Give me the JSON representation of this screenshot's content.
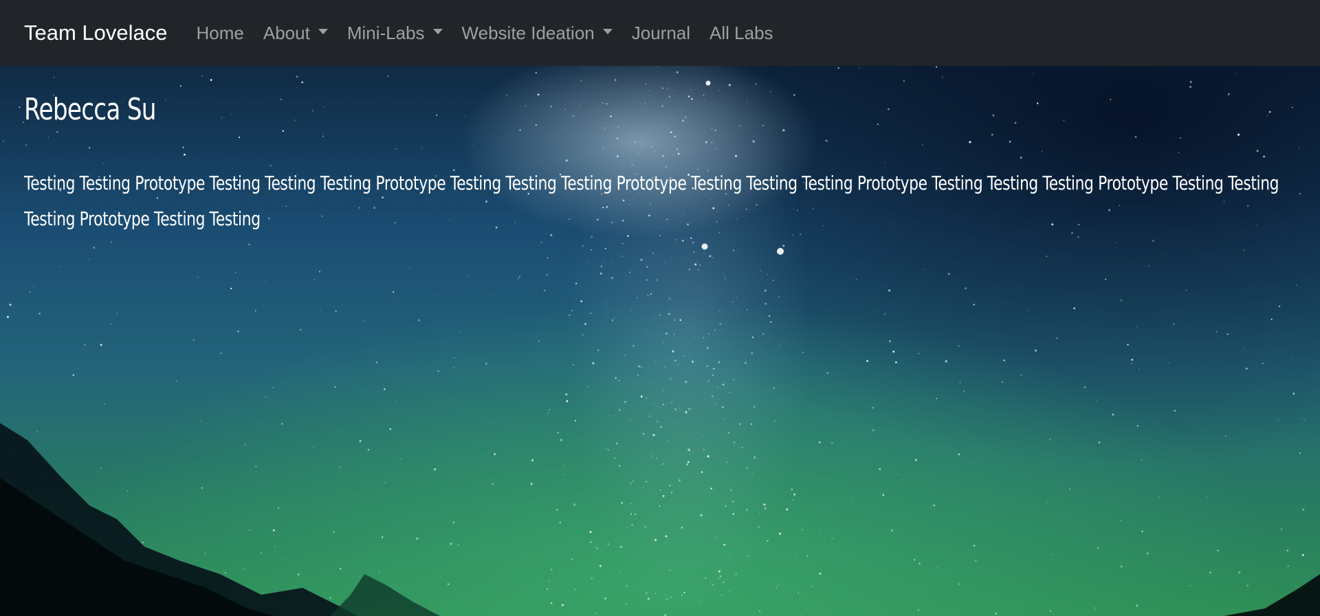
{
  "navbar": {
    "brand": "Team Lovelace",
    "items": [
      {
        "label": "Home",
        "dropdown": false
      },
      {
        "label": "About",
        "dropdown": true
      },
      {
        "label": "Mini-Labs",
        "dropdown": true
      },
      {
        "label": "Website Ideation",
        "dropdown": true
      },
      {
        "label": "Journal",
        "dropdown": false
      },
      {
        "label": "All Labs",
        "dropdown": false
      }
    ],
    "background_color": "#212529",
    "link_color": "rgba(255,255,255,0.56)"
  },
  "main": {
    "name": "Rebecca Su",
    "paragraph": "Testing Testing Prototype Testing Testing Testing Prototype Testing Testing Testing Prototype Testing Testing Testing Prototype Testing Testing Testing Prototype Testing Testing Testing Prototype Testing Testing",
    "background": "starry night sky with milky way",
    "text_color": "#ffffff"
  },
  "icons": {
    "dropdown": "caret-down-icon"
  }
}
